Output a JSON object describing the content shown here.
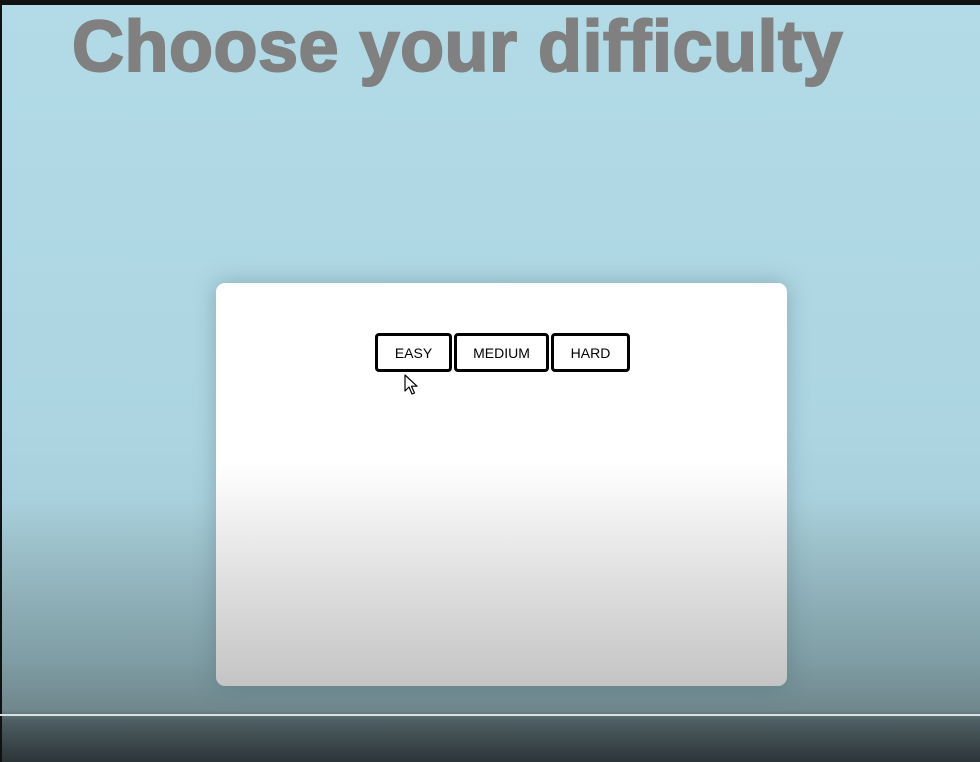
{
  "page": {
    "title": "Choose your difficulty"
  },
  "difficulty": {
    "options": [
      {
        "label": "EASY"
      },
      {
        "label": "MEDIUM"
      },
      {
        "label": "HARD"
      }
    ]
  },
  "colors": {
    "background": "#b2dbe7",
    "title": "#808080",
    "panel": "#ffffff",
    "button_border": "#000000"
  },
  "icons": {
    "cursor": "mouse-pointer-icon"
  }
}
